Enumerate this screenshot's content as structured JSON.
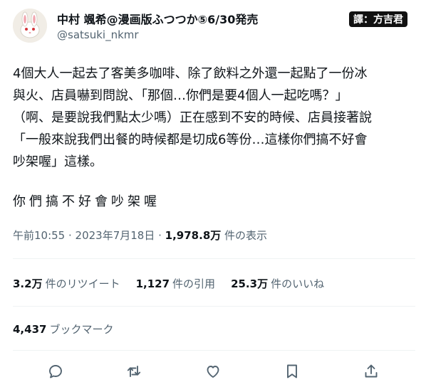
{
  "user": {
    "display_name": "中村 颯希@漫画版ふつつか⑤6/30発売",
    "handle": "@satsuki_nkmr",
    "avatar_icon": "rabbit-icon"
  },
  "translator_badge": "譯：方吉君",
  "tweet": {
    "lines": [
      "4個大人一起去了客美多咖啡、除了飲料之外還一起點了一份冰",
      "與火、店員嚇到問說、「那個…你們是要4個人一起吃嗎？」",
      "（啊、是要說我們點太少嗎）正在感到不安的時候、店員接著說",
      "「一般來說我們出餐的時候都是切成6等份…這樣你們搞不好會",
      "吵架喔」這樣。"
    ],
    "tail": "你們搞不好會吵架喔"
  },
  "meta": {
    "time": "午前10:55",
    "sep1": " · ",
    "date": "2023年7月18日",
    "sep2": " · ",
    "views": "1,978.8万",
    "views_label": " 件の表示"
  },
  "stats": {
    "retweets": {
      "count": "3.2万",
      "label": "件のリツイート"
    },
    "quotes": {
      "count": "1,127",
      "label": "件の引用"
    },
    "likes": {
      "count": "25.3万",
      "label": "件のいいね"
    },
    "bookmarks": {
      "count": "4,437",
      "label": "ブックマーク"
    }
  },
  "actions": [
    {
      "name": "reply-icon"
    },
    {
      "name": "retweet-icon"
    },
    {
      "name": "like-icon"
    },
    {
      "name": "bookmark-icon"
    },
    {
      "name": "share-icon"
    }
  ],
  "colors": {
    "text": "#0f1419",
    "secondary": "#536471",
    "divider": "#eff3f4"
  }
}
